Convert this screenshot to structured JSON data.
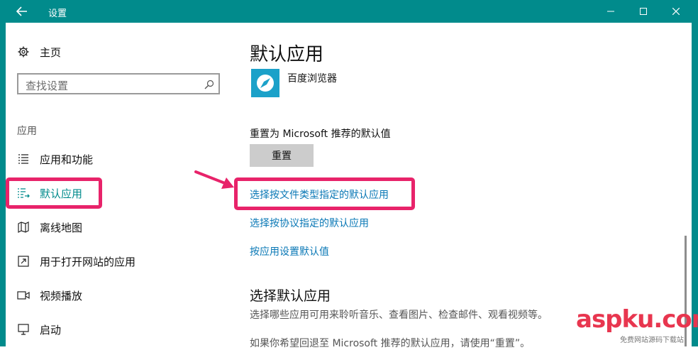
{
  "window": {
    "title": "设置",
    "controls": [
      "minimize",
      "maximize",
      "close"
    ]
  },
  "sidebar": {
    "home_label": "主页",
    "search": {
      "placeholder": "查找设置"
    },
    "section_label": "应用",
    "items": [
      {
        "label": "应用和功能",
        "icon": "list-icon"
      },
      {
        "label": "默认应用",
        "icon": "default-apps-icon",
        "selected": true
      },
      {
        "label": "离线地图",
        "icon": "map-icon"
      },
      {
        "label": "用于打开网站的应用",
        "icon": "website-app-icon"
      },
      {
        "label": "视频播放",
        "icon": "video-icon"
      },
      {
        "label": "启动",
        "icon": "startup-icon"
      }
    ]
  },
  "main": {
    "title": "默认应用",
    "browser": {
      "name": "百度浏览器"
    },
    "reset": {
      "description": "重置为 Microsoft 推荐的默认值",
      "button_label": "重置"
    },
    "links": [
      "选择按文件类型指定的默认应用",
      "选择按协议指定的默认应用",
      "按应用设置默认值"
    ],
    "choose_section": {
      "heading": "选择默认应用",
      "desc1": "选择哪些应用可用来聆听音乐、查看图片、检查邮件、观看视频等。",
      "desc2": "如果你希望回退至 Microsoft 推荐的默认应用，请使用“重置”。"
    }
  },
  "watermark": {
    "logo": "aspku.com",
    "tagline": "免费网站源码下载站"
  },
  "colors": {
    "accent": "#018b8c",
    "link": "#0a78b6",
    "highlight": "#e8236a"
  }
}
